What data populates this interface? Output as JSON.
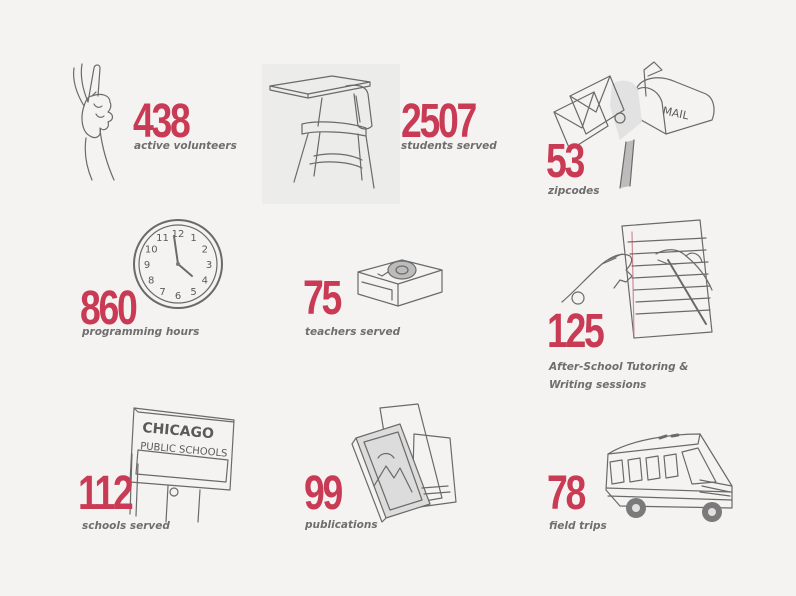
{
  "stats": [
    {
      "value": "438",
      "label": "active volunteers",
      "icon": "peace-hand-icon"
    },
    {
      "value": "2507",
      "label": "students served",
      "icon": "school-desk-icon"
    },
    {
      "value": "53",
      "label": "zipcodes",
      "icon": "mailbox-icon"
    },
    {
      "value": "860",
      "label": "programming hours",
      "icon": "wall-clock-icon"
    },
    {
      "value": "75",
      "label": "teachers served",
      "icon": "tape-dispenser-icon"
    },
    {
      "value": "125",
      "label": "After-School Tutoring &",
      "label2": "Writing sessions",
      "icon": "writing-hands-icon"
    },
    {
      "value": "112",
      "label": "schools served",
      "icon": "chicago-public-schools-sign-icon"
    },
    {
      "value": "99",
      "label": "publications",
      "icon": "book-stack-icon"
    },
    {
      "value": "78",
      "label": "field trips",
      "icon": "school-bus-icon"
    }
  ],
  "illustration_text": {
    "mail": "MAIL",
    "sign_line1": "CHICAGO",
    "sign_line2": "PUBLIC SCHOOLS",
    "clock_numbers": [
      "12",
      "1",
      "2",
      "3",
      "4",
      "5",
      "6",
      "7",
      "8",
      "9",
      "10",
      "11"
    ]
  },
  "colors": {
    "accent": "#c93b55",
    "label": "#6e6e6e",
    "background": "#f4f3f1"
  }
}
